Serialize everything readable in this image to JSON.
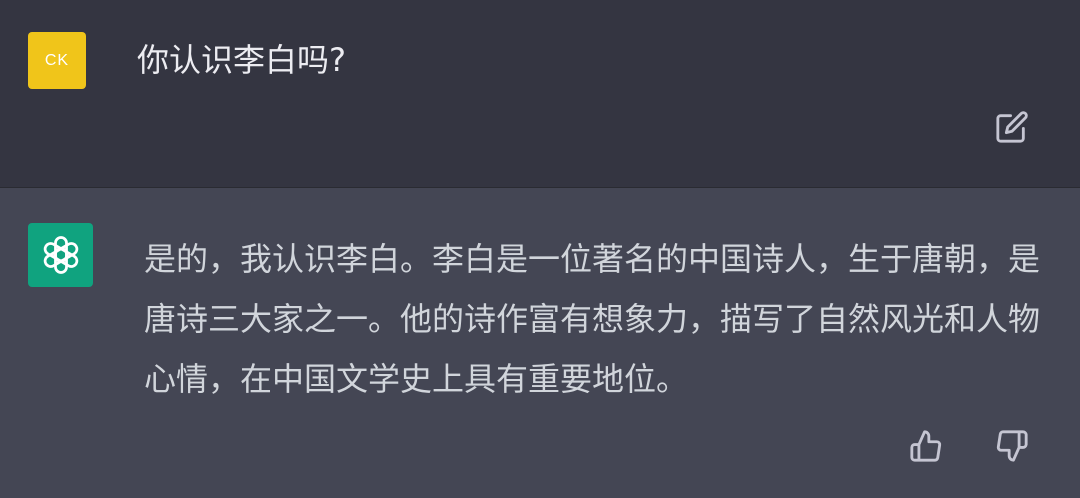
{
  "conversation": {
    "user": {
      "avatar_initials": "CK",
      "avatar_color": "#f0c51a",
      "message": "你认识李白吗?"
    },
    "assistant": {
      "avatar_icon": "openai-logo-icon",
      "avatar_color": "#10a37f",
      "message": "是的，我认识李白。李白是一位著名的中国诗人，生于唐朝，是唐诗三大家之一。他的诗作富有想象力，描写了自然风光和人物心情，在中国文学史上具有重要地位。"
    }
  },
  "actions": {
    "edit_icon": "edit-icon",
    "thumbs_up_icon": "thumbs-up-icon",
    "thumbs_down_icon": "thumbs-down-icon"
  },
  "colors": {
    "user_row_bg": "#343541",
    "assistant_row_bg": "#444654",
    "text": "#ececf1"
  }
}
